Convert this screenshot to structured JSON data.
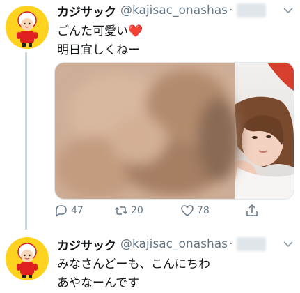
{
  "tweets": [
    {
      "name": "カジサック",
      "handle": "@kajisac_onashas",
      "separator": "·",
      "text_lines": [
        "ごんた可愛い❤️",
        "明日宜しくねー"
      ],
      "actions": {
        "replies": "47",
        "retweets": "20",
        "likes": "78"
      }
    },
    {
      "name": "カジサック",
      "handle": "@kajisac_onashas",
      "separator": "·",
      "text_lines": [
        "みなさんどーも、こんにちわ",
        "あやなーんです"
      ]
    }
  ],
  "icons": {
    "reply": "reply-icon",
    "retweet": "retweet-icon",
    "like": "heart-icon",
    "share": "share-icon",
    "more": "chevron-down-icon"
  },
  "colors": {
    "avatar_bg": "#ffd21f",
    "secondary_text": "#657786",
    "thread_line": "#ccd6dd",
    "heart_emoji": "#e0245e"
  }
}
